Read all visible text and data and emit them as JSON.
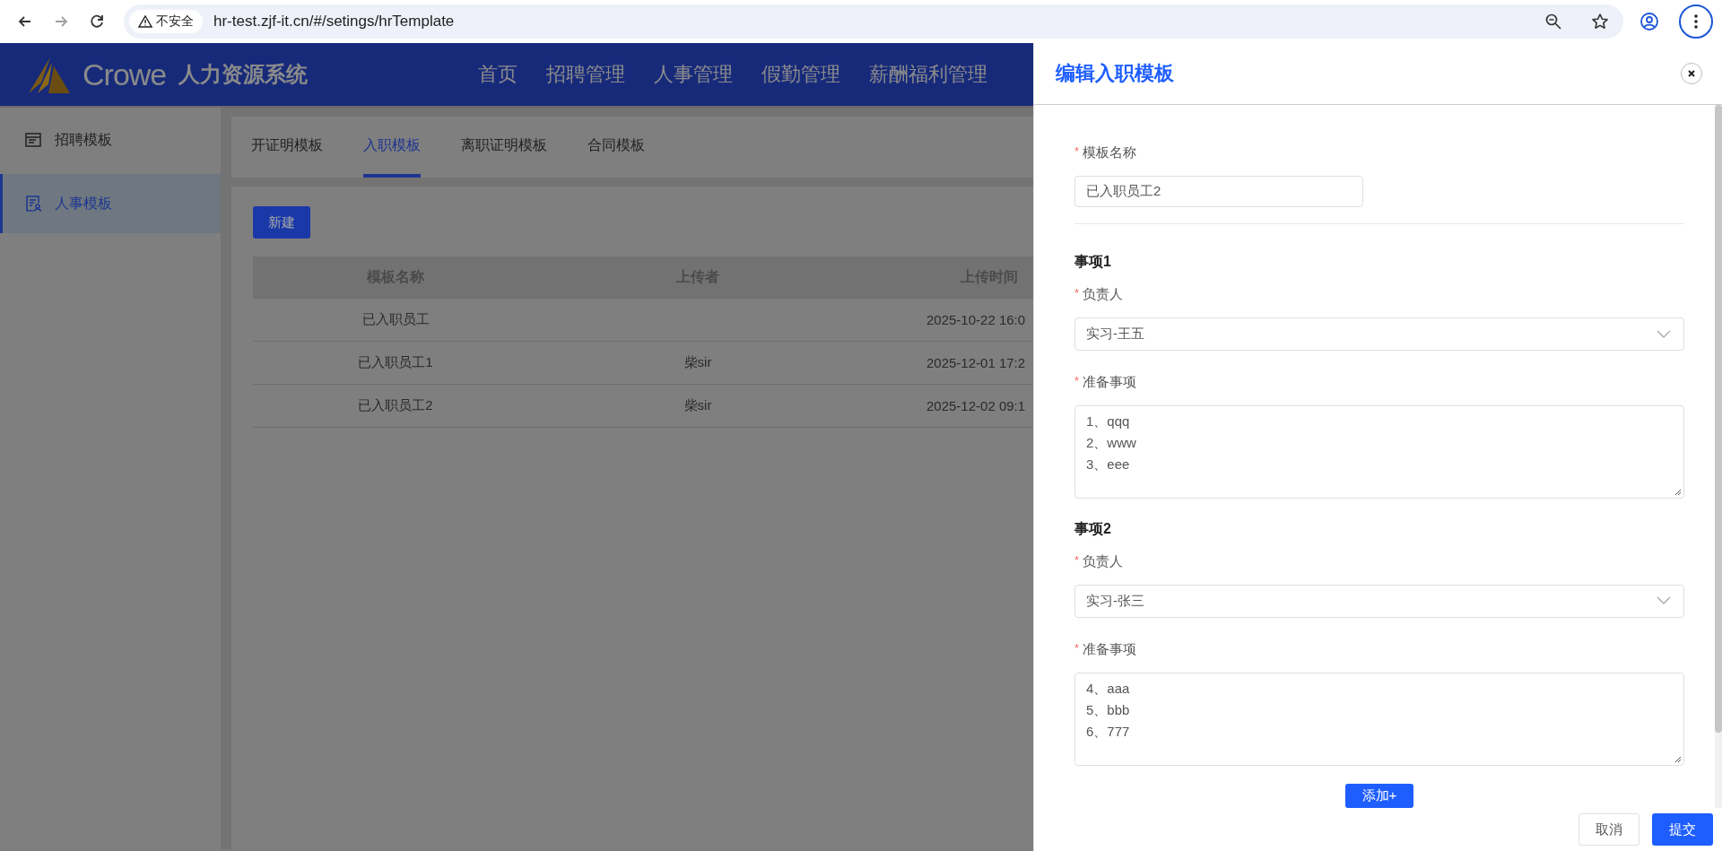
{
  "browser": {
    "nav_buttons": [
      {
        "kind": "back",
        "disabled": false
      },
      {
        "kind": "forward",
        "disabled": true
      },
      {
        "kind": "reload",
        "disabled": false
      }
    ],
    "security_label": "不安全",
    "url": "hr-test.zjf-it.cn/#/setings/hrTemplate"
  },
  "header": {
    "brand": "Crowe",
    "system_name": "人力资源系统",
    "nav": [
      "首页",
      "招聘管理",
      "人事管理",
      "假勤管理",
      "薪酬福利管理"
    ]
  },
  "sidebar": {
    "items": [
      {
        "label": "招聘模板",
        "kind": "list",
        "selected": false
      },
      {
        "label": "人事模板",
        "kind": "person",
        "selected": true
      }
    ]
  },
  "tabs": [
    {
      "label": "开证明模板",
      "selected": false
    },
    {
      "label": "入职模板",
      "selected": true
    },
    {
      "label": "离职证明模板",
      "selected": false
    },
    {
      "label": "合同模板",
      "selected": false
    }
  ],
  "new_button": "新建",
  "table": {
    "columns": [
      "模板名称",
      "上传者",
      "上传时间"
    ],
    "rows": [
      {
        "cells": [
          "已入职员工",
          "",
          "2025-10-22 16:0"
        ]
      },
      {
        "cells": [
          "已入职员工1",
          "柴sir",
          "2025-12-01 17:2"
        ]
      },
      {
        "cells": [
          "已入职员工2",
          "柴sir",
          "2025-12-02 09:1"
        ]
      }
    ]
  },
  "drawer": {
    "title": "编辑入职模板",
    "required_mark": "*",
    "template_name": {
      "label": "模板名称",
      "required": true,
      "value": "已入职员工2"
    },
    "items": [
      {
        "heading": "事项1",
        "owner": {
          "label": "负责人",
          "required": true,
          "value": "实习-王五"
        },
        "prep": {
          "label": "准备事项",
          "required": true,
          "value": "1、qqq\n2、www\n3、eee"
        }
      },
      {
        "heading": "事项2",
        "owner": {
          "label": "负责人",
          "required": true,
          "value": "实习-张三"
        },
        "prep": {
          "label": "准备事项",
          "required": true,
          "value": "4、aaa\n5、bbb\n6、777"
        }
      }
    ],
    "add_button": "添加+",
    "cancel_button": "取消",
    "submit_button": "提交"
  }
}
